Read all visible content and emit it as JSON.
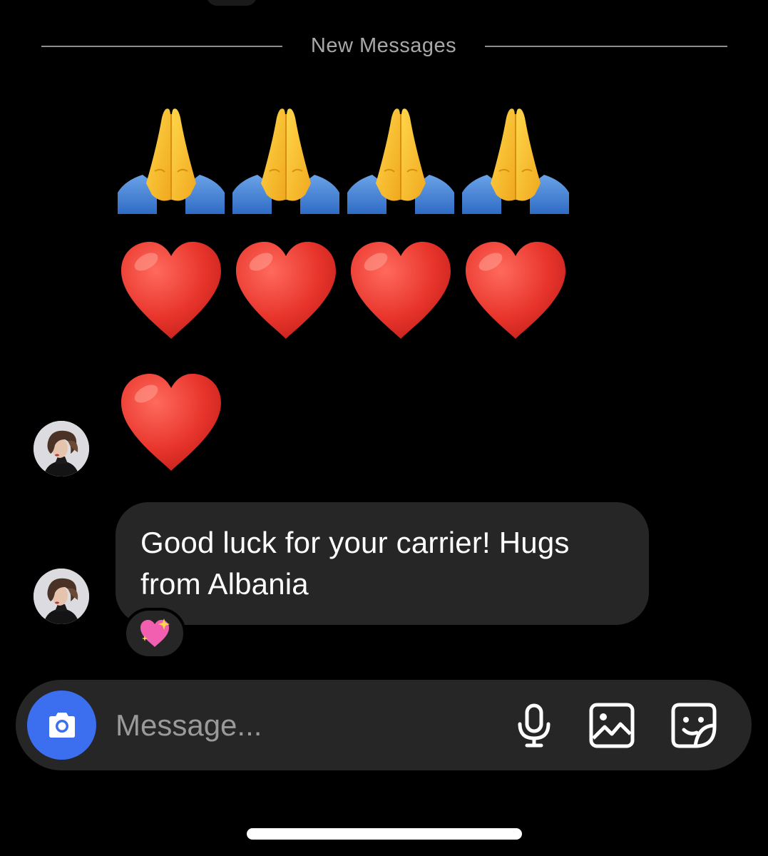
{
  "divider": {
    "label": "New Messages"
  },
  "emoji_messages": {
    "row1": [
      "folded-hands",
      "folded-hands",
      "folded-hands",
      "folded-hands"
    ],
    "row2": [
      "red-heart",
      "red-heart",
      "red-heart",
      "red-heart"
    ],
    "row3": [
      "red-heart"
    ]
  },
  "message": {
    "text": "Good luck for your carrier! Hugs from Albania",
    "reaction": "sparkling-heart"
  },
  "composer": {
    "placeholder": "Message...",
    "camera_icon": "camera-icon",
    "mic_icon": "microphone-icon",
    "gallery_icon": "gallery-icon",
    "sticker_icon": "sticker-icon"
  },
  "colors": {
    "background": "#000000",
    "bubble": "#262626",
    "accent": "#3b6ff0",
    "divider_text": "#a8a8a8"
  }
}
